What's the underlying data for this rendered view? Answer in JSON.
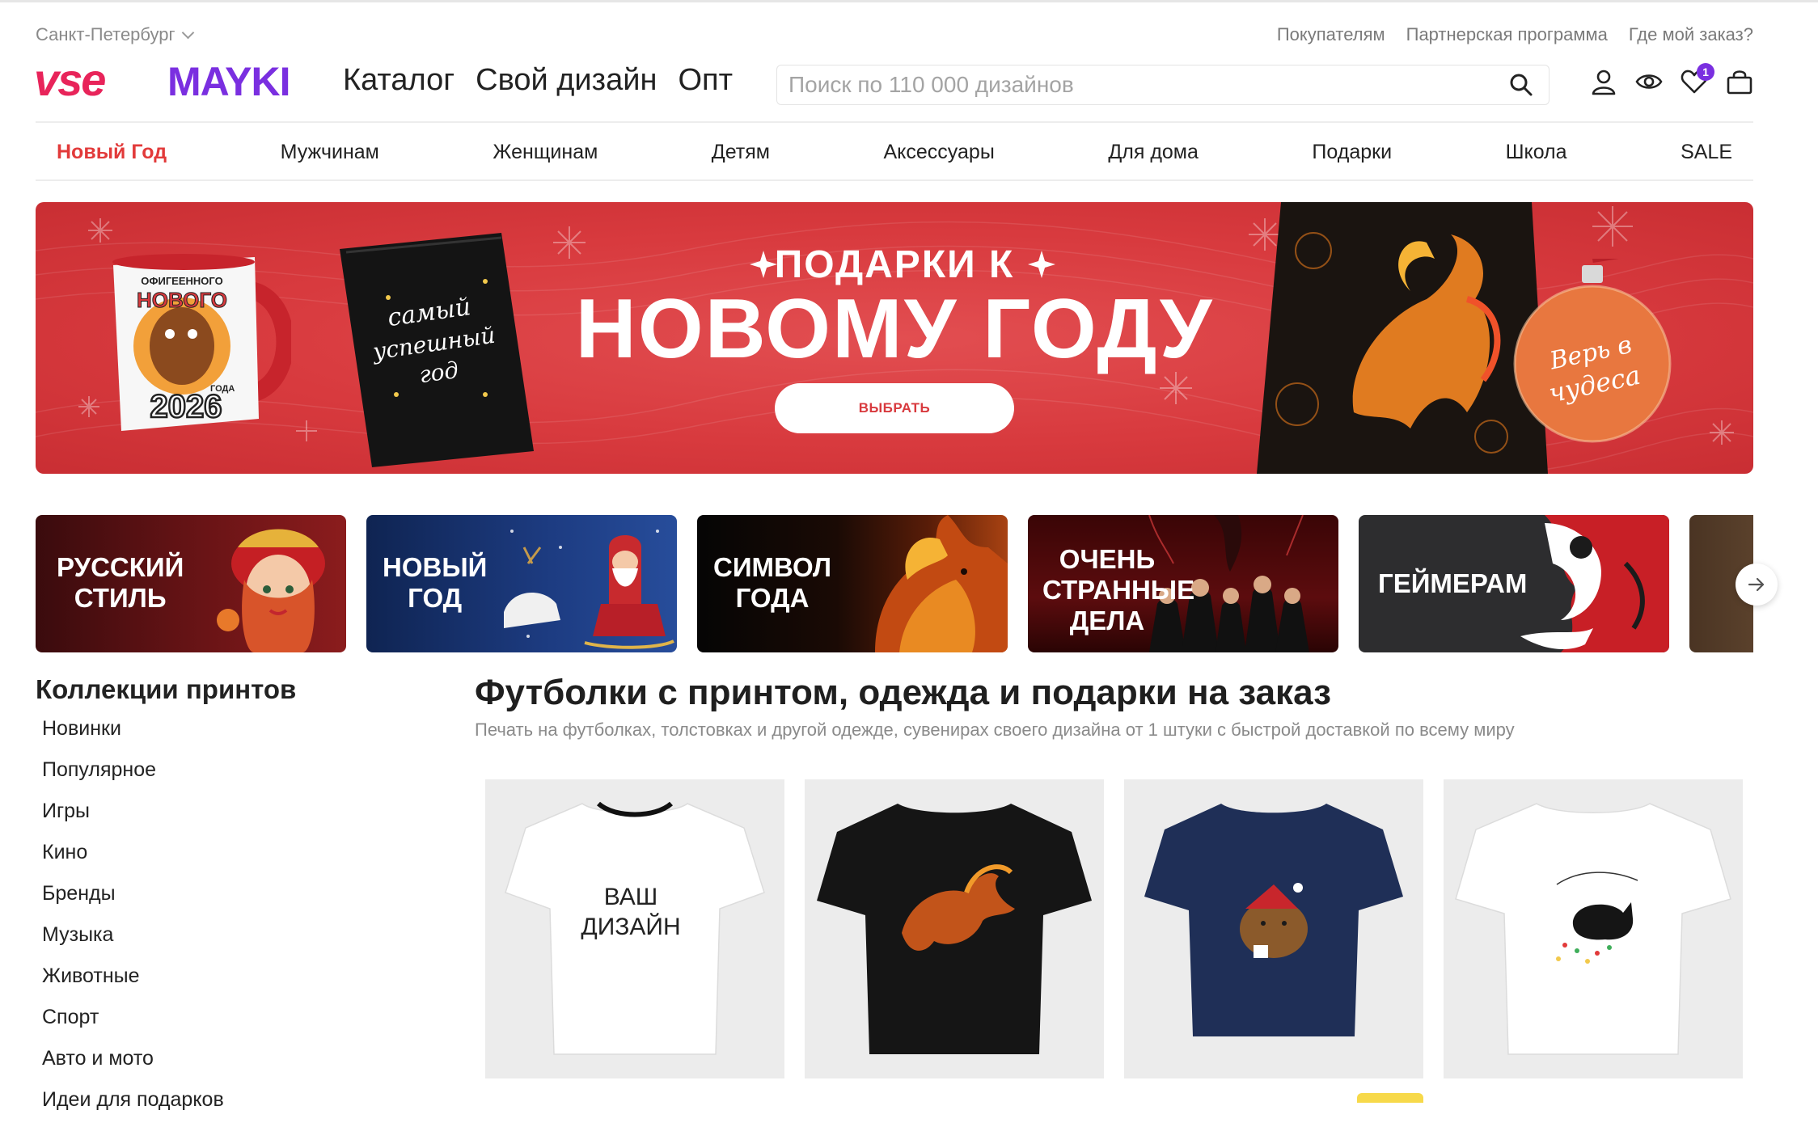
{
  "location": {
    "city": "Санкт-Петербург"
  },
  "top_links": [
    "Покупателям",
    "Партнерская программа",
    "Где мой заказ?"
  ],
  "logo": {
    "part1": "vse",
    "part2": "MAYKI"
  },
  "main_nav": [
    "Каталог",
    "Свой дизайн",
    "Опт"
  ],
  "search": {
    "placeholder": "Поиск по 110 000 дизайнов",
    "value": ""
  },
  "header_icons": {
    "account": "user-icon",
    "viewed": "eye-icon",
    "favorites": "heart-icon",
    "favorites_count": "1",
    "cart": "bag-icon"
  },
  "category_nav": [
    {
      "label": "Новый Год",
      "active": true
    },
    {
      "label": "Мужчинам"
    },
    {
      "label": "Женщинам"
    },
    {
      "label": "Детям"
    },
    {
      "label": "Аксессуары"
    },
    {
      "label": "Для дома"
    },
    {
      "label": "Подарки"
    },
    {
      "label": "Школа"
    },
    {
      "label": "SALE"
    }
  ],
  "hero": {
    "small_title": "ПОДАРКИ К",
    "big_title": "НОВОМУ ГОДУ",
    "button": "ВЫБРАТЬ",
    "mug_text_top": "ОФИГЕЕННОГО",
    "mug_text_mid": "НОВОГО",
    "mug_text_year_label": "ГОДА",
    "mug_year": "2026",
    "notebook_text": [
      "самый",
      "успешный",
      "год"
    ],
    "ornament_text": [
      "Верь в",
      "чудеса"
    ],
    "colors": {
      "background": "#d83a3e",
      "button_text": "#d83a3e"
    }
  },
  "collections": [
    {
      "label": "РУССКИЙ\nСТИЛЬ"
    },
    {
      "label": "НОВЫЙ\nГОД"
    },
    {
      "label": "СИМВОЛ\nГОДА"
    },
    {
      "label": "ОЧЕНЬ\nСТРАННЫЕ\nДЕЛА"
    },
    {
      "label": "ГЕЙМЕРАМ"
    }
  ],
  "sidebar": {
    "title": "Коллекции принтов",
    "items": [
      "Новинки",
      "Популярное",
      "Игры",
      "Кино",
      "Бренды",
      "Музыка",
      "Животные",
      "Спорт",
      "Авто и мото",
      "Идеи для подарков"
    ]
  },
  "main": {
    "title": "Футболки с принтом, одежда и подарки на заказ",
    "subtitle": "Печать на футболках, толстовках и другой одежде, сувенирах своего дизайна от 1 штуки с быстрой доставкой по всему миру"
  },
  "products": [
    {
      "shirt_color": "#ffffff",
      "print": "ВАШ\nДИЗАЙН"
    },
    {
      "shirt_color": "#151515",
      "print": "fire-horse"
    },
    {
      "shirt_color": "#1f2f57",
      "print": "capybara"
    },
    {
      "shirt_color": "#ffffff",
      "print": "black-cat"
    }
  ],
  "brand_colors": {
    "logo_pink": "#e8245a",
    "logo_purple": "#7a2fe0",
    "accent_red": "#e23a3a"
  }
}
